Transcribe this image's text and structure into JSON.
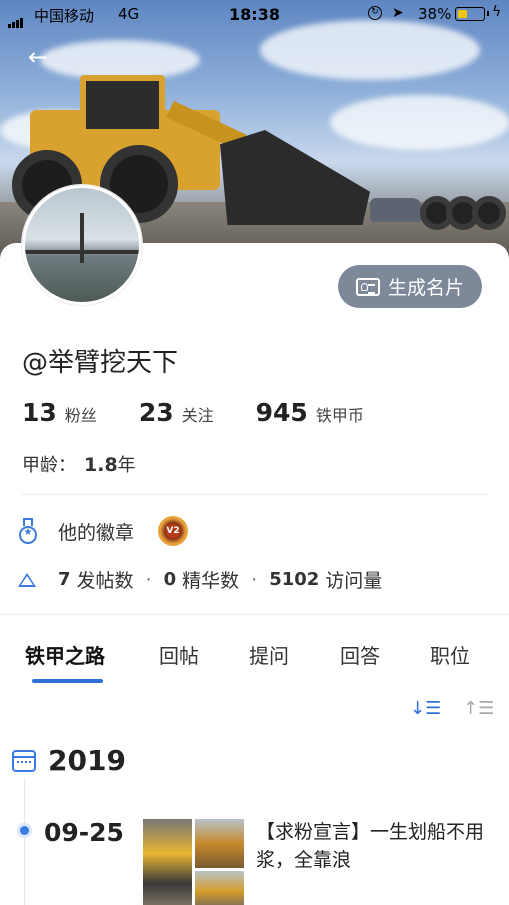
{
  "status_bar": {
    "carrier": "中国移动",
    "network": "4G",
    "time": "18:38",
    "battery_percent": "38%",
    "battery_level": 0.38
  },
  "profile": {
    "username": "@举臂挖天下",
    "generate_card_label": "生成名片",
    "stats": [
      {
        "value": "13",
        "label": "粉丝"
      },
      {
        "value": "23",
        "label": "关注"
      },
      {
        "value": "945",
        "label": "铁甲币"
      }
    ],
    "age_label": "甲龄：",
    "age_value": "1.8",
    "age_unit": "年",
    "badges_label": "他的徽章",
    "badge_text": "V2",
    "posts_count": "7",
    "posts_label": "发帖数",
    "featured_count": "0",
    "featured_label": "精华数",
    "visits_count": "5102",
    "visits_label": "访问量",
    "dot": "·"
  },
  "tabs": [
    {
      "label": "铁甲之路",
      "active": true
    },
    {
      "label": "回帖",
      "active": false
    },
    {
      "label": "提问",
      "active": false
    },
    {
      "label": "回答",
      "active": false
    },
    {
      "label": "职位",
      "active": false
    }
  ],
  "timeline": {
    "year": "2019",
    "entries": [
      {
        "date": "09-25",
        "title": "【求粉宣言】一生划船不用浆，全靠浪"
      }
    ]
  },
  "colors": {
    "accent": "#2f6fd9",
    "card_button_bg": "#7d8899"
  },
  "icons": {
    "back": "arrow-left-icon",
    "generate_card": "id-card-icon",
    "badge": "medal-icon",
    "posts": "triangle-icon",
    "calendar": "calendar-icon",
    "sort_desc": "sort-descending-icon",
    "sort_asc": "sort-ascending-icon"
  }
}
